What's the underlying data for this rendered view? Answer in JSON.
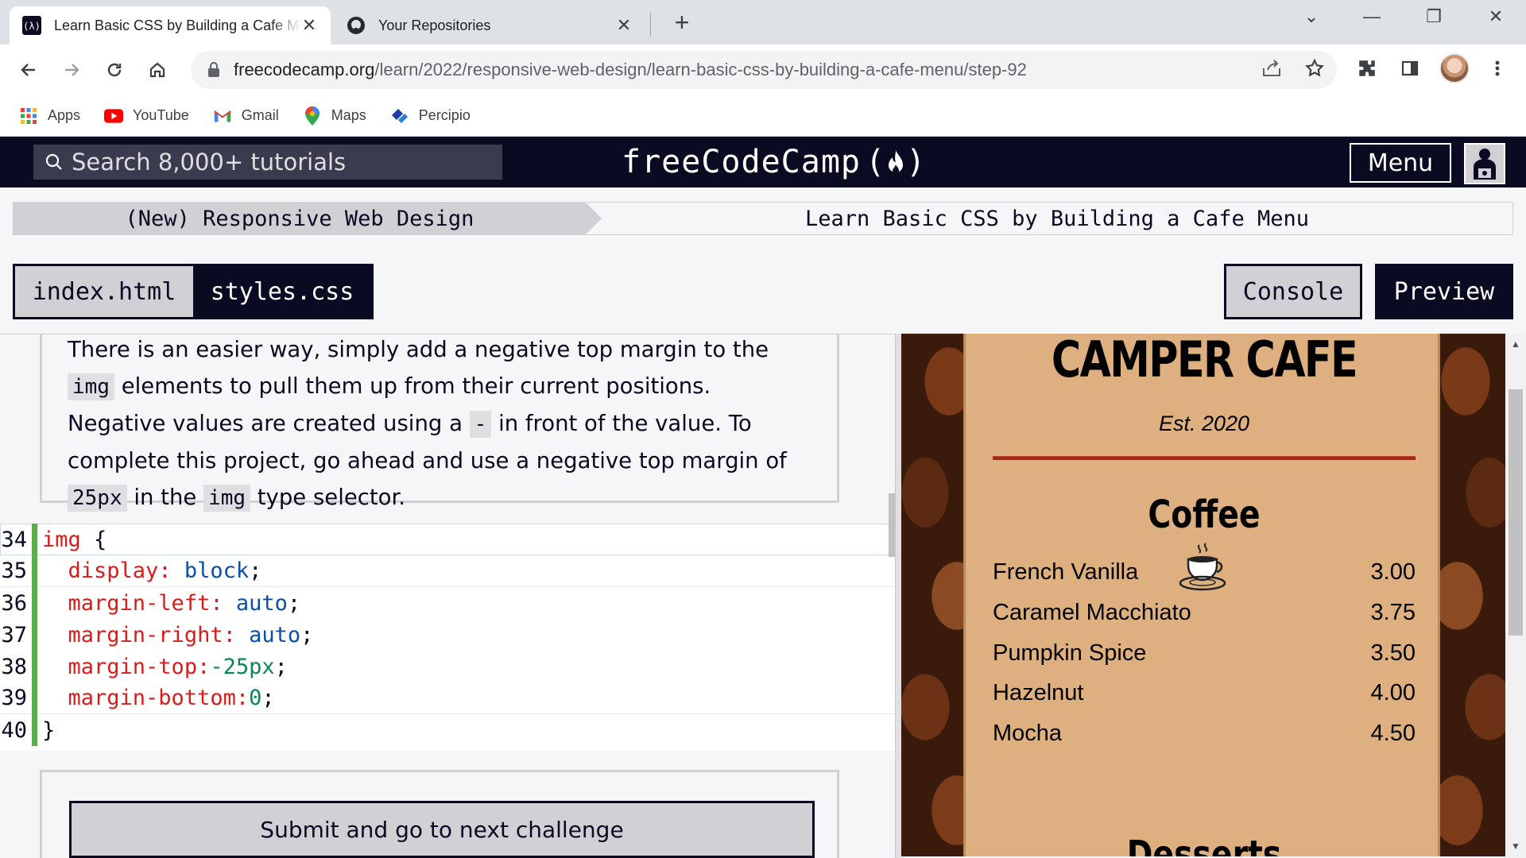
{
  "browser": {
    "tabs": [
      {
        "title": "Learn Basic CSS by Building a Cafe Menu",
        "active": true
      },
      {
        "title": "Your Repositories",
        "active": false
      }
    ],
    "url_host": "freecodecamp.org",
    "url_path": "/learn/2022/responsive-web-design/learn-basic-css-by-building-a-cafe-menu/step-92",
    "bookmarks": [
      {
        "label": "Apps",
        "icon": "apps-grid-icon"
      },
      {
        "label": "YouTube",
        "icon": "youtube-icon"
      },
      {
        "label": "Gmail",
        "icon": "gmail-icon"
      },
      {
        "label": "Maps",
        "icon": "maps-icon"
      },
      {
        "label": "Percipio",
        "icon": "percipio-icon"
      }
    ]
  },
  "fcc": {
    "search_placeholder": "Search 8,000+ tutorials",
    "logo_text": "freeCodeCamp",
    "menu_label": "Menu",
    "breadcrumb_left": "(New) Responsive Web Design",
    "breadcrumb_right": "Learn Basic CSS by Building a Cafe Menu",
    "file_tabs": [
      "index.html",
      "styles.css"
    ],
    "active_file": "styles.css",
    "console_label": "Console",
    "preview_label": "Preview"
  },
  "description": {
    "p1": "There is an easier way, simply add a negative top margin to the ",
    "c1": "img",
    "p2": " elements to pull them up from their current positions. Negative values are created using a ",
    "c2": "-",
    "p3": " in front of the value. To complete this project, go ahead and use a negative top margin of ",
    "c3": "25px",
    "p4": " in the ",
    "c4": "img",
    "p5": " type selector."
  },
  "code": {
    "line_numbers": [
      "34",
      "35",
      "36",
      "37",
      "38",
      "39",
      "40"
    ],
    "l34_selector": "img",
    "l34_brace": " {",
    "l35_prop": "display:",
    "l35_val": " block",
    "l36_prop": "margin-left:",
    "l36_val": " auto",
    "l37_prop": "margin-right:",
    "l37_val": " auto",
    "l38_prop": "margin-top:",
    "l38_val": "-25px",
    "l39_prop": "margin-bottom:",
    "l39_val": "0",
    "semicolon": ";",
    "l40": "}"
  },
  "submit_label": "Submit and go to next challenge",
  "preview": {
    "title": "CAMPER CAFE",
    "established": "Est. 2020",
    "section_coffee": "Coffee",
    "section_next": "Desserts",
    "coffee_items": [
      {
        "name": "French Vanilla",
        "price": "3.00"
      },
      {
        "name": "Caramel Macchiato",
        "price": "3.75"
      },
      {
        "name": "Pumpkin Spice",
        "price": "3.50"
      },
      {
        "name": "Hazelnut",
        "price": "4.00"
      },
      {
        "name": "Mocha",
        "price": "4.50"
      }
    ]
  },
  "colors": {
    "fcc_dark": "#0a0a23",
    "fcc_gray": "#d0d0d5",
    "menu_bg": "#dfb07f",
    "hr_red": "#9b2b1d",
    "gutter_green": "#5aac4c"
  }
}
